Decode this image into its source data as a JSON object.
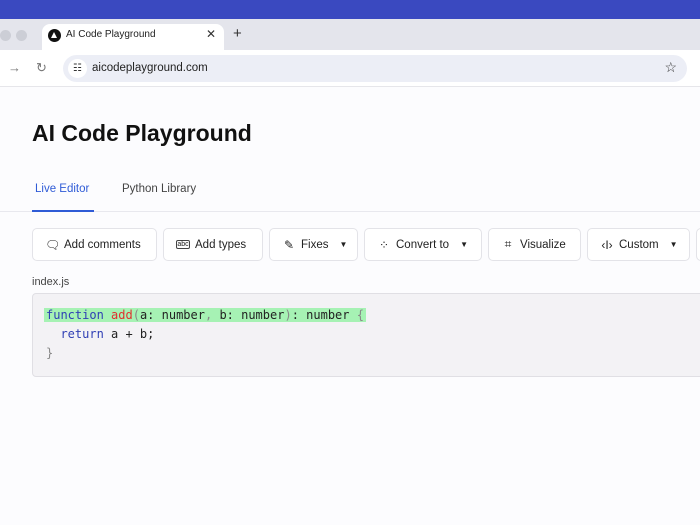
{
  "browser": {
    "tab_title": "AI Code Playground",
    "url": "aicodeplayground.com"
  },
  "page": {
    "title": "AI Code Playground",
    "tabs": [
      {
        "label": "Live Editor"
      },
      {
        "label": "Python Library"
      }
    ]
  },
  "toolbar": [
    {
      "label": "Add comments",
      "icon": "comment-icon"
    },
    {
      "label": "Add types",
      "icon": "abc-icon"
    },
    {
      "label": "Fixes",
      "icon": "pencil-icon"
    },
    {
      "label": "Convert to",
      "icon": "convert-icon"
    },
    {
      "label": "Visualize",
      "icon": "graph-icon"
    },
    {
      "label": "Custom",
      "icon": "cursor-icon"
    }
  ],
  "editor": {
    "filename": "index.js",
    "code": {
      "l1": {
        "kw": "function",
        "fn": "add",
        "p1": "(",
        "a": "a: number",
        "c": ", ",
        "b": "b: number",
        "p2": ")",
        "rest": ": number ",
        "brace": "{"
      },
      "l2": {
        "kw": "return",
        "rest": " a + b;"
      },
      "l3": "}"
    }
  },
  "colors": {
    "accent": "#2f5bd6",
    "highlight": "#a6f2b4"
  }
}
